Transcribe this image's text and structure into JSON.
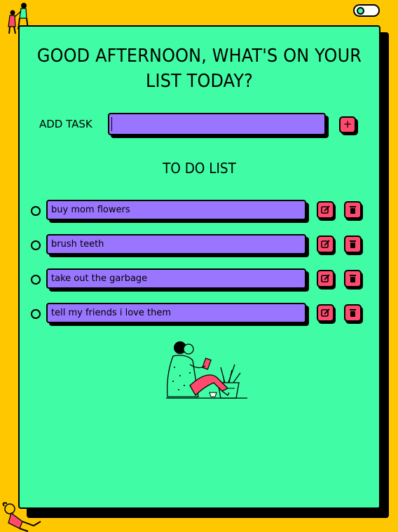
{
  "header": {
    "theme_toggle_state": "off",
    "title": "GOOD AFTERNOON, WHAT'S ON YOUR LIST TODAY?"
  },
  "add_task": {
    "label": "ADD TASK",
    "input_value": "",
    "button_label": "+"
  },
  "list": {
    "heading": "TO DO LIST",
    "items": [
      {
        "text": "buy mom flowers",
        "done": false
      },
      {
        "text": "brush teeth",
        "done": false
      },
      {
        "text": "take out the garbage",
        "done": false
      },
      {
        "text": "tell my friends i love them",
        "done": false
      }
    ]
  },
  "icons": {
    "edit": "edit-icon",
    "delete": "trash-icon",
    "add": "plus-icon"
  },
  "colors": {
    "background": "#FFC700",
    "card": "#40FCA5",
    "task": "#9A75FF",
    "button": "#FF4A6E"
  }
}
